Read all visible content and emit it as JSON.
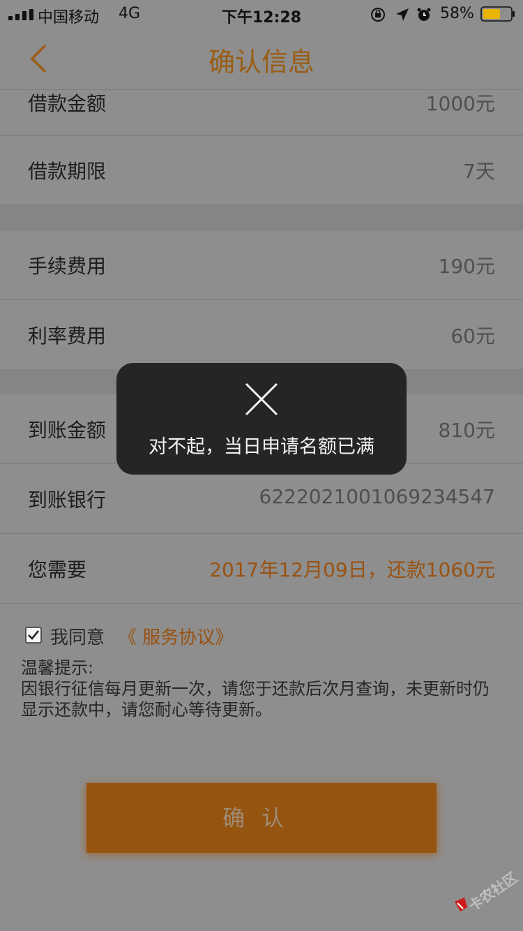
{
  "status_bar": {
    "carrier": "中国移动",
    "network": "4G",
    "time": "下午12:28",
    "battery_percent": "58%",
    "icons": [
      "orientation-lock-icon",
      "location-arrow-icon",
      "alarm-icon"
    ]
  },
  "nav": {
    "title": "确认信息",
    "back_icon": "chevron-left-icon"
  },
  "loan": {
    "amount": {
      "label": "借款金额",
      "value": "1000元"
    },
    "term": {
      "label": "借款期限",
      "value": "7天"
    },
    "fee": {
      "label": "手续费用",
      "value": "190元"
    },
    "interest": {
      "label": "利率费用",
      "value": "60元"
    },
    "received": {
      "label": "到账金额",
      "value": "810元"
    },
    "bank": {
      "label": "到账银行",
      "value": "6222021001069234547"
    },
    "repay": {
      "label": "您需要",
      "value": "2017年12月09日，还款1060元"
    }
  },
  "agreement": {
    "checked": true,
    "text": "我同意",
    "link": "《 服务协议》"
  },
  "tips": {
    "title": "温馨提示:",
    "body": "因银行征信每月更新一次，请您于还款后次月查询，未更新时仍显示还款中，请您耐心等待更新。"
  },
  "confirm_button": {
    "label": "确认"
  },
  "toast": {
    "icon": "close-icon",
    "message": "对不起，当日申请名额已满"
  },
  "watermark": {
    "text": "卡农社区"
  },
  "colors": {
    "accent": "#9a5d13",
    "button": "#955410",
    "overlay_bg": "#8e8e8e",
    "toast_bg": "#252525"
  }
}
